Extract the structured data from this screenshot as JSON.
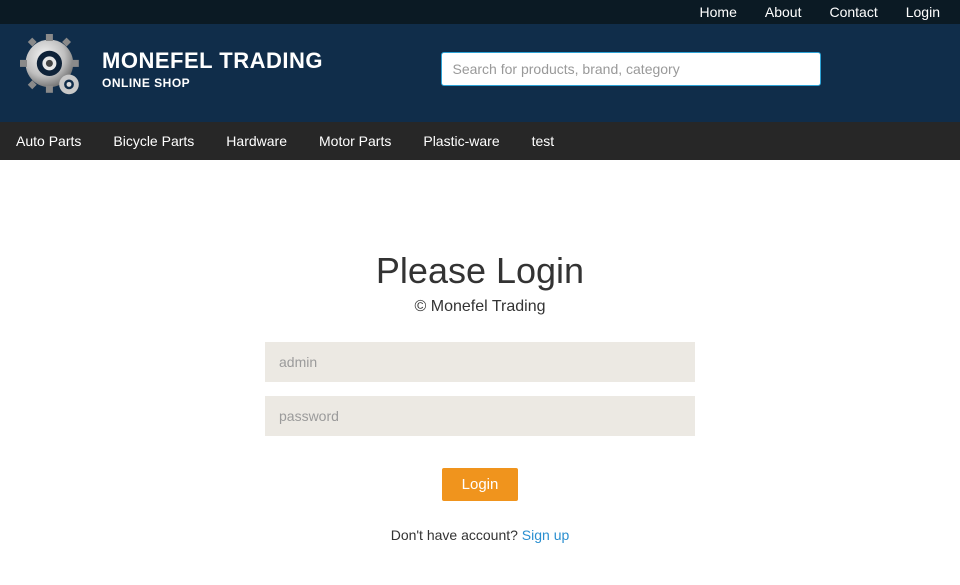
{
  "topnav": {
    "home": "Home",
    "about": "About",
    "contact": "Contact",
    "login": "Login"
  },
  "brand": {
    "name": "MONEFEL TRADING",
    "subtitle": "ONLINE SHOP"
  },
  "search": {
    "placeholder": "Search for products, brand, category",
    "value": ""
  },
  "categories": [
    "Auto Parts",
    "Bicycle Parts",
    "Hardware",
    "Motor Parts",
    "Plastic-ware",
    "test"
  ],
  "login": {
    "title": "Please Login",
    "subtitle": "© Monefel Trading",
    "username_placeholder": "admin",
    "password_placeholder": "password",
    "button": "Login",
    "signup_prompt": "Don't have account? ",
    "signup_link": "Sign up"
  }
}
